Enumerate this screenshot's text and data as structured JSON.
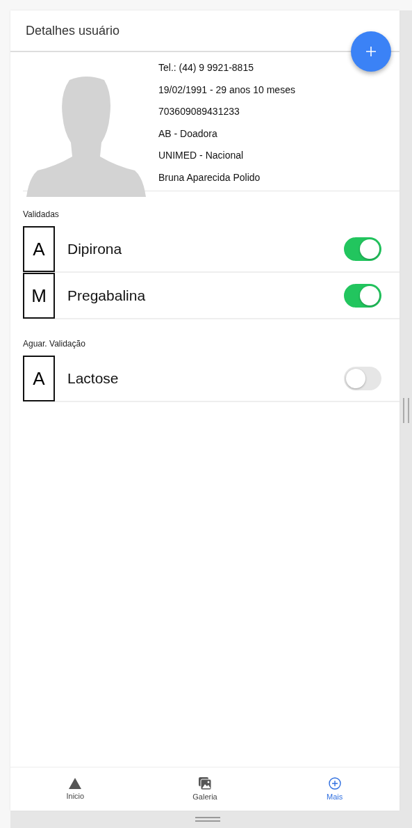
{
  "header": {
    "title": "Detalhes usuário"
  },
  "profile": {
    "lines": [
      "Tel.: (44) 9 9921-8815",
      "19/02/1991 - 29 anos 10 meses",
      "703609089431233",
      "AB - Doadora",
      "UNIMED - Nacional",
      "Bruna Aparecida Polido"
    ]
  },
  "sections": [
    {
      "title": "Validadas",
      "items": [
        {
          "letter": "A",
          "name": "Dipirona",
          "on": true
        },
        {
          "letter": "M",
          "name": "Pregabalina",
          "on": true
        }
      ]
    },
    {
      "title": "Aguar. Validação",
      "items": [
        {
          "letter": "A",
          "name": "Lactose",
          "on": false
        }
      ]
    }
  ],
  "bottom_nav": [
    {
      "kind": "home",
      "label": "Inicio",
      "selected": false
    },
    {
      "kind": "gallery",
      "label": "Galeria",
      "selected": false
    },
    {
      "kind": "more",
      "label": "Mais",
      "selected": true
    }
  ]
}
